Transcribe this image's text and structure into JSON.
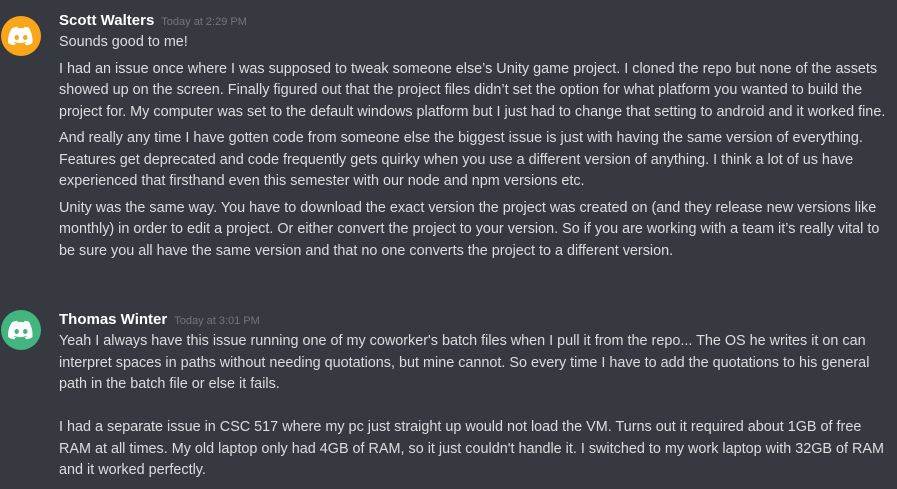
{
  "colors": {
    "background": "#36393f",
    "avatar_scott": "#faa61a",
    "avatar_thomas": "#43b581",
    "username": "#ffffff",
    "timestamp": "#72767d",
    "text": "#dcddde"
  },
  "messages": [
    {
      "avatar_icon": "discord-logo-icon",
      "username": "Scott Walters",
      "timestamp": "Today at 2:29 PM",
      "paragraphs": [
        "Sounds good to me!",
        "I had an issue once where I was supposed to tweak someone else’s Unity game project. I cloned the repo but none of the assets showed up on the screen. Finally figured out that the project files didn’t set the option for what platform you wanted to build the project for. My computer was set to the default windows platform but I just had to change that setting to android and it worked fine.",
        "And really any time I have gotten code from someone else the biggest issue is just with having the same version of everything. Features get deprecated and code frequently gets quirky when you use a different version of anything. I think a lot of us have experienced that firsthand even this semester with our node and npm versions etc.",
        "Unity was the same way. You have to download the exact version the project was created on (and they release new versions like monthly) in order to edit a project. Or either convert the project to your version. So if you are working with a team it’s really vital to be sure you all have the same version and that no one converts the project to a different version."
      ]
    },
    {
      "avatar_icon": "discord-logo-icon",
      "username": "Thomas Winter",
      "timestamp": "Today at 3:01 PM",
      "paragraphs": [
        "Yeah I always have this issue running one of my coworker's batch files when I pull it from the repo... The OS he writes it on can interpret spaces in paths without needing quotations, but mine cannot. So every time I have to add the quotations to his general path in the batch file or else it fails.",
        "I had a separate issue in CSC 517 where my pc just straight up would not load the VM. Turns out it required about 1GB of free RAM at all times. My old laptop only had 4GB of RAM, so it just couldn't handle it. I switched to my work laptop with 32GB of RAM and it worked perfectly."
      ]
    }
  ]
}
